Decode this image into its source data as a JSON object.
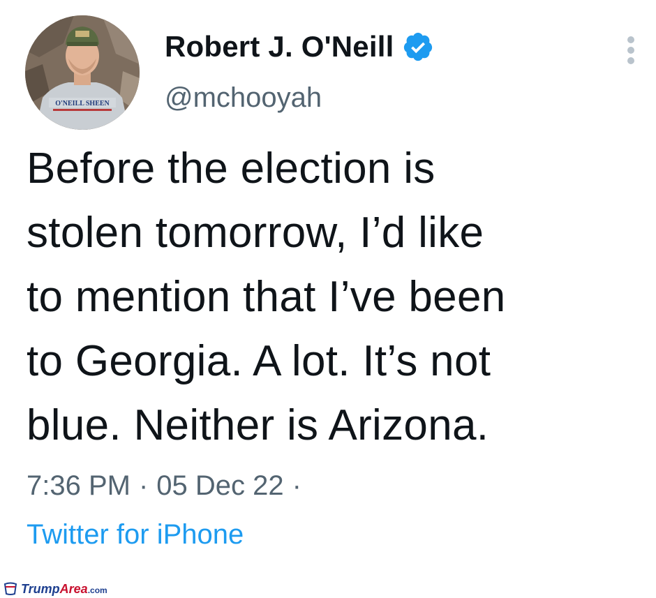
{
  "author": {
    "display_name": "Robert J. O'Neill",
    "handle": "@mchooyah",
    "verified": true,
    "avatar_shirt_text": "O'NEILL SHEEN"
  },
  "tweet": {
    "text": "Before the election is\nstolen tomorrow, I’d like\nto mention that I’ve been\nto Georgia. A lot. It’s not\nblue. Neither is Arizona.",
    "time": "7:36 PM",
    "date": "05 Dec 22",
    "separator": "·",
    "source": "Twitter for iPhone"
  },
  "watermark": {
    "brand_first": "Trump",
    "brand_second": "Area",
    "suffix": ".com"
  },
  "icons": {
    "verified": "verified-badge-icon",
    "more": "more-options-icon",
    "watermark": "cup-logo-icon"
  },
  "colors": {
    "text_primary": "#0f1419",
    "text_secondary": "#536471",
    "link_blue": "#1d9bf0",
    "verified_blue": "#1d9bf0",
    "watermark_blue": "#1d3f8f",
    "watermark_red": "#c8102e"
  }
}
